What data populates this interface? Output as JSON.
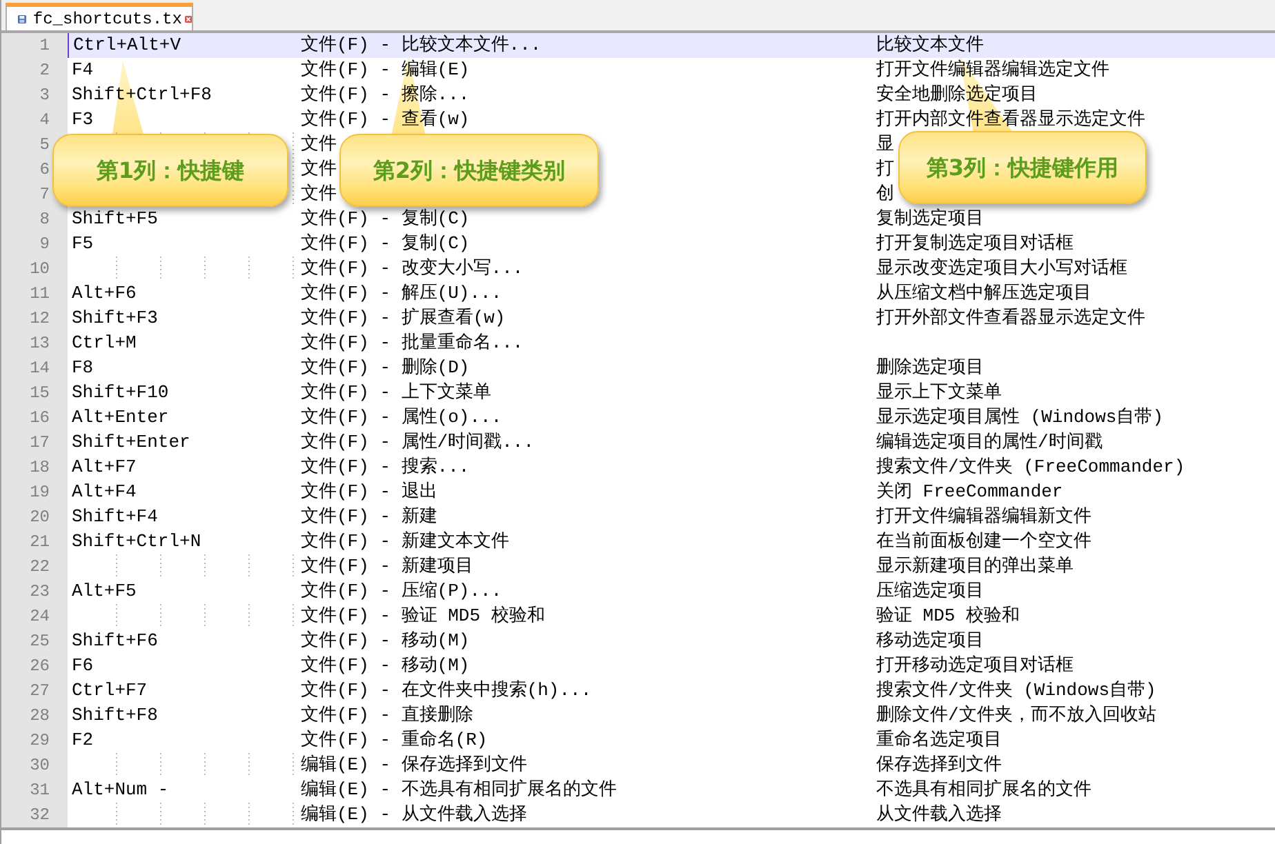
{
  "tab": {
    "title": "fc_shortcuts.tx",
    "selected": true
  },
  "editor": {
    "lines": [
      {
        "number": "1",
        "selected": true,
        "shortcut": "Ctrl+Alt+V",
        "category": "文件(F) - 比较文本文件...",
        "description": "比较文本文件"
      },
      {
        "number": "2",
        "selected": false,
        "shortcut": "F4",
        "category": "文件(F) - 编辑(E)",
        "description": "打开文件编辑器编辑选定文件"
      },
      {
        "number": "3",
        "selected": false,
        "shortcut": "Shift+Ctrl+F8",
        "category": "文件(F) - 擦除...",
        "description": "安全地删除选定项目"
      },
      {
        "number": "4",
        "selected": false,
        "shortcut": "F3",
        "category": "文件(F) - 查看(w)",
        "description": "打开内部文件查看器显示选定文件"
      },
      {
        "number": "5",
        "selected": false,
        "category": "文件",
        "description": "显"
      },
      {
        "number": "6",
        "selected": false,
        "category": "文件",
        "description": "打"
      },
      {
        "number": "7",
        "selected": false,
        "category": "文件",
        "description": "创"
      },
      {
        "number": "8",
        "selected": false,
        "shortcut": "Shift+F5",
        "category": "文件(F) - 复制(C)",
        "description": "复制选定项目"
      },
      {
        "number": "9",
        "selected": false,
        "shortcut": "F5",
        "category": "文件(F) - 复制(C)",
        "description": "打开复制选定项目对话框"
      },
      {
        "number": "10",
        "selected": false,
        "category": "文件(F) - 改变大小写...",
        "description": "显示改变选定项目大小写对话框"
      },
      {
        "number": "11",
        "selected": false,
        "shortcut": "Alt+F6",
        "category": "文件(F) - 解压(U)...",
        "description": "从压缩文档中解压选定项目"
      },
      {
        "number": "12",
        "selected": false,
        "shortcut": "Shift+F3",
        "category": "文件(F) - 扩展查看(w)",
        "description": "打开外部文件查看器显示选定文件"
      },
      {
        "number": "13",
        "selected": false,
        "shortcut": "Ctrl+M",
        "category": "文件(F) - 批量重命名..."
      },
      {
        "number": "14",
        "selected": false,
        "shortcut": "F8",
        "category": "文件(F) - 删除(D)",
        "description": "删除选定项目"
      },
      {
        "number": "15",
        "selected": false,
        "shortcut": "Shift+F10",
        "category": "文件(F) - 上下文菜单",
        "description": "显示上下文菜单"
      },
      {
        "number": "16",
        "selected": false,
        "shortcut": "Alt+Enter",
        "category": "文件(F) - 属性(o)...",
        "description": "显示选定项目属性 (Windows自带)"
      },
      {
        "number": "17",
        "selected": false,
        "shortcut": "Shift+Enter",
        "category": "文件(F) - 属性/时间戳...",
        "description": "编辑选定项目的属性/时间戳"
      },
      {
        "number": "18",
        "selected": false,
        "shortcut": "Alt+F7",
        "category": "文件(F) - 搜索...",
        "description": "搜索文件/文件夹 (FreeCommander)"
      },
      {
        "number": "19",
        "selected": false,
        "shortcut": "Alt+F4",
        "category": "文件(F) - 退出",
        "description": "关闭 FreeCommander"
      },
      {
        "number": "20",
        "selected": false,
        "shortcut": "Shift+F4",
        "category": "文件(F) - 新建",
        "description": "打开文件编辑器编辑新文件"
      },
      {
        "number": "21",
        "selected": false,
        "shortcut": "Shift+Ctrl+N",
        "category": "文件(F) - 新建文本文件",
        "description": "在当前面板创建一个空文件"
      },
      {
        "number": "22",
        "selected": false,
        "category": "文件(F) - 新建项目",
        "description": "显示新建项目的弹出菜单"
      },
      {
        "number": "23",
        "selected": false,
        "shortcut": "Alt+F5",
        "category": "文件(F) - 压缩(P)...",
        "description": "压缩选定项目"
      },
      {
        "number": "24",
        "selected": false,
        "category": "文件(F) - 验证 MD5 校验和",
        "description": "验证 MD5 校验和"
      },
      {
        "number": "25",
        "selected": false,
        "shortcut": "Shift+F6",
        "category": "文件(F) - 移动(M)",
        "description": "移动选定项目"
      },
      {
        "number": "26",
        "selected": false,
        "shortcut": "F6",
        "category": "文件(F) - 移动(M)",
        "description": "打开移动选定项目对话框"
      },
      {
        "number": "27",
        "selected": false,
        "shortcut": "Ctrl+F7",
        "category": "文件(F) - 在文件夹中搜索(h)...",
        "description": "搜索文件/文件夹 (Windows自带)"
      },
      {
        "number": "28",
        "selected": false,
        "shortcut": "Shift+F8",
        "category": "文件(F) - 直接删除",
        "description": "删除文件/文件夹，而不放入回收站"
      },
      {
        "number": "29",
        "selected": false,
        "shortcut": "F2",
        "category": "文件(F) - 重命名(R)",
        "description": "重命名选定项目"
      },
      {
        "number": "30",
        "selected": false,
        "category": "编辑(E) - 保存选择到文件",
        "description": "保存选择到文件"
      },
      {
        "number": "31",
        "selected": false,
        "shortcut": "Alt+Num -",
        "category": "编辑(E) - 不选具有相同扩展名的文件",
        "description": "不选具有相同扩展名的文件"
      },
      {
        "number": "32",
        "selected": false,
        "category": "编辑(E) - 从文件载入选择",
        "description": "从文件载入选择"
      }
    ]
  },
  "callouts": [
    {
      "text": "第1列：快捷键"
    },
    {
      "text": "第2列：快捷键类别"
    },
    {
      "text": "第3列：快捷键作用"
    }
  ]
}
